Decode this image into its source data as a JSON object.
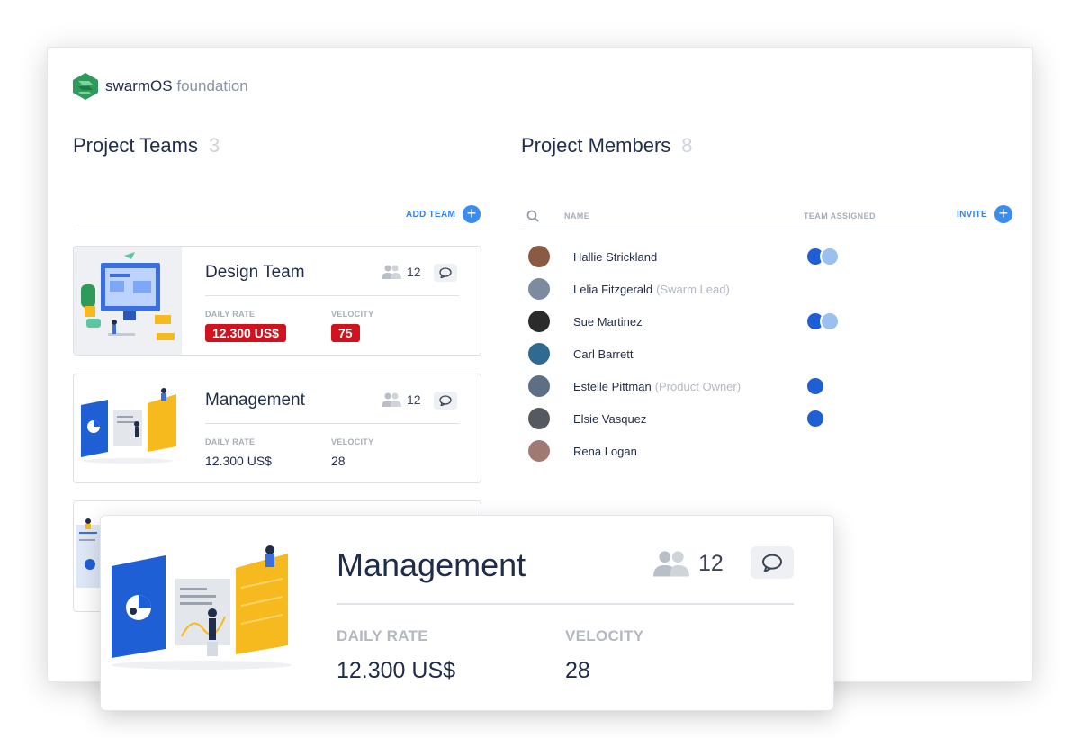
{
  "brand": {
    "name": "swarmOS",
    "suffix": "foundation"
  },
  "teams_section": {
    "title": "Project Teams",
    "count": "3",
    "add_label": "ADD TEAM"
  },
  "members_section": {
    "title": "Project Members",
    "count": "8",
    "invite_label": "INVITE",
    "col_name": "NAME",
    "col_team": "TEAM ASSIGNED"
  },
  "teams": [
    {
      "name": "Design Team",
      "members": "12",
      "rate_label": "DAILY RATE",
      "rate": "12.300 US$",
      "velocity_label": "VELOCITY",
      "velocity": "75",
      "highlight": true
    },
    {
      "name": "Management",
      "members": "12",
      "rate_label": "DAILY RATE",
      "rate": "12.300 US$",
      "velocity_label": "VELOCITY",
      "velocity": "28",
      "highlight": false
    }
  ],
  "members": [
    {
      "name": "Hallie Strickland",
      "role": "",
      "avatar_color": "#8a5a44",
      "teams": 2
    },
    {
      "name": "Lelia Fitzgerald",
      "role": "(Swarm Lead)",
      "avatar_color": "#7c8ba0",
      "teams": 0
    },
    {
      "name": "Sue Martinez",
      "role": "",
      "avatar_color": "#2b2b2b",
      "teams": 2
    },
    {
      "name": "Carl Barrett",
      "role": "",
      "avatar_color": "#2f6a92",
      "teams": 0
    },
    {
      "name": "Estelle Pittman",
      "role": "(Product Owner)",
      "avatar_color": "#5d6f85",
      "teams": 1
    },
    {
      "name": "Elsie Vasquez",
      "role": "",
      "avatar_color": "#555a60",
      "teams": 1
    },
    {
      "name": "Rena Logan",
      "role": "",
      "avatar_color": "#a07a72",
      "teams": 0
    }
  ],
  "zoom_card": {
    "name": "Management",
    "members": "12",
    "rate_label": "DAILY RATE",
    "rate": "12.300 US$",
    "velocity_label": "VELOCITY",
    "velocity": "28"
  },
  "colors": {
    "accent": "#3b8cf0",
    "alert": "#d0131f",
    "brand_green": "#2e9a5b"
  }
}
